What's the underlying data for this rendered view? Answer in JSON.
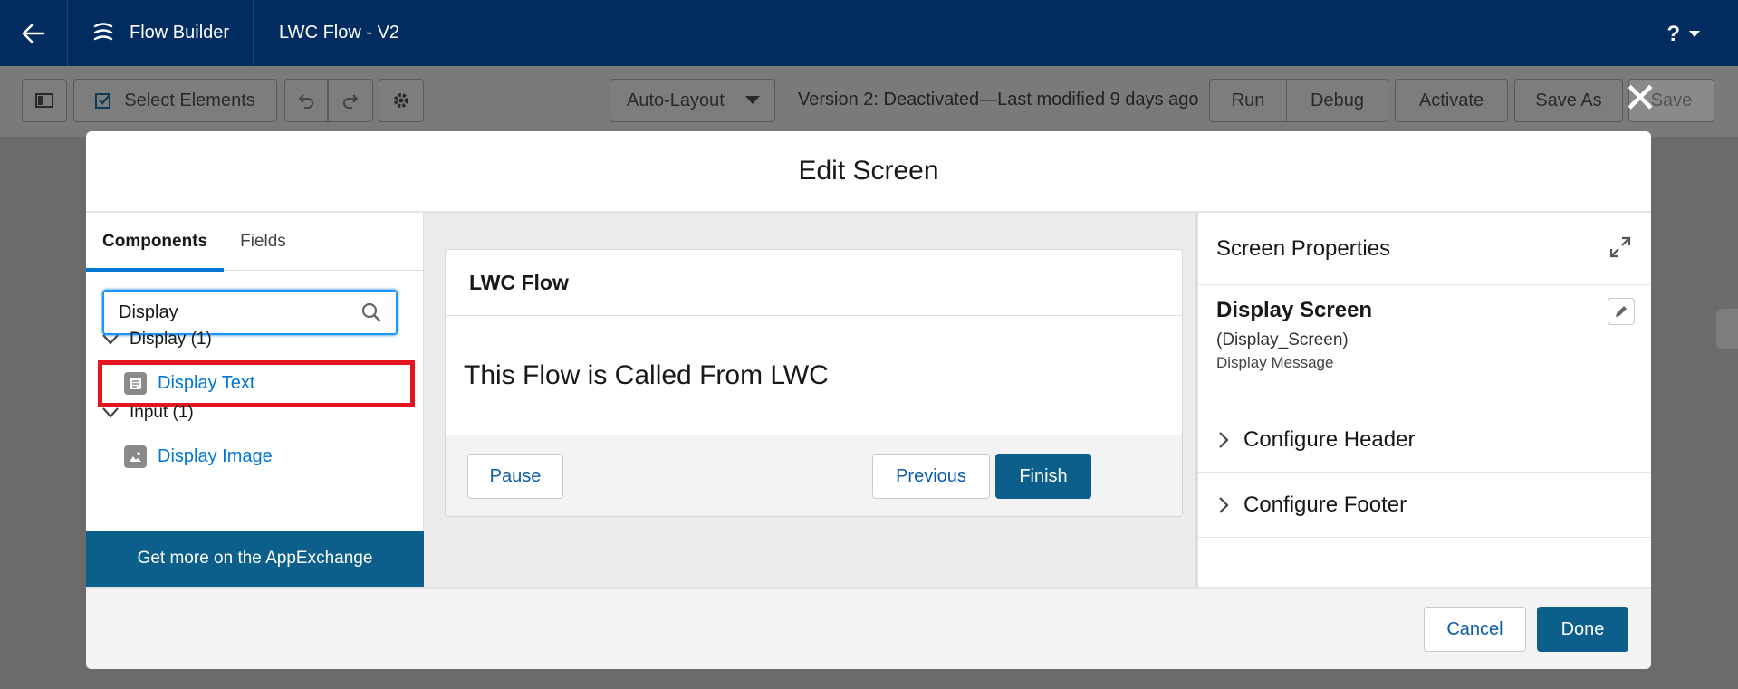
{
  "topnav": {
    "app_name": "Flow Builder",
    "flow_name": "LWC Flow - V2",
    "help_label": "?"
  },
  "toolbar": {
    "select_elements": "Select Elements",
    "layout_select": "Auto-Layout",
    "version_status": "Version 2: Deactivated—Last modified 9 days ago",
    "run": "Run",
    "debug": "Debug",
    "activate": "Activate",
    "save_as": "Save As",
    "save": "Save"
  },
  "modal": {
    "title": "Edit Screen",
    "close_glyph": "✕",
    "left": {
      "tabs": [
        {
          "label": "Components",
          "active": true
        },
        {
          "label": "Fields",
          "active": false
        }
      ],
      "search_value": "Display",
      "groups": [
        {
          "label": "Display (1)",
          "items": [
            {
              "label": "Display Text"
            }
          ]
        },
        {
          "label": "Input (1)",
          "items": [
            {
              "label": "Display Image"
            }
          ]
        }
      ],
      "appexchange": "Get more on the AppExchange"
    },
    "center": {
      "header": "LWC Flow",
      "content": "This Flow is Called From LWC",
      "pause": "Pause",
      "previous": "Previous",
      "finish": "Finish"
    },
    "right": {
      "title": "Screen Properties",
      "screen_name": "Display Screen",
      "api_name": "(Display_Screen)",
      "description": "Display Message",
      "sections": [
        "Configure Header",
        "Configure Footer"
      ]
    },
    "footer": {
      "cancel": "Cancel",
      "done": "Done"
    }
  },
  "colors": {
    "nav_bg": "#032d60",
    "brand": "#0b5f8a",
    "link": "#0176d3",
    "highlight": "#e3161f"
  }
}
